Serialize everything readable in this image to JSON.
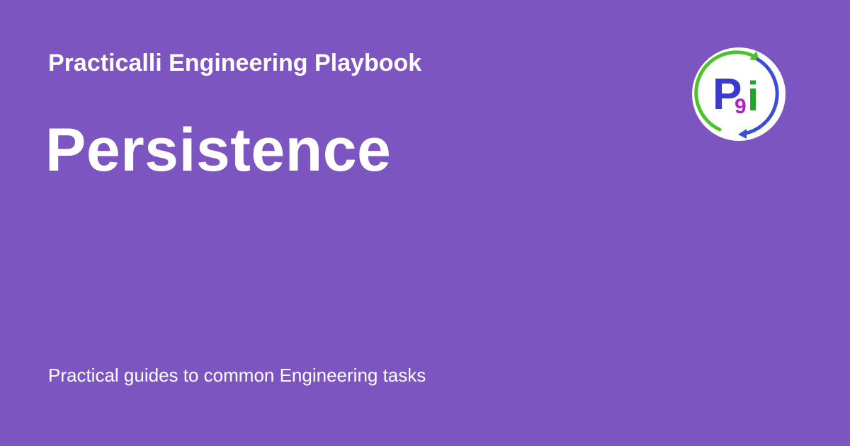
{
  "site_name": "Practicalli Engineering Playbook",
  "page_title": "Persistence",
  "description": "Practical guides to common Engineering tasks",
  "logo": {
    "icon": "practicalli-logo-icon",
    "letters": [
      "P",
      "9",
      "i"
    ],
    "colors": {
      "letter_p": "#3a3acc",
      "digit_9": "#b020c8",
      "letter_i": "#1fa52a",
      "arrow_green": "#4cc32a",
      "arrow_blue": "#3b4fd6"
    }
  },
  "colors": {
    "background": "#7c55c1",
    "text": "#ffffff"
  }
}
